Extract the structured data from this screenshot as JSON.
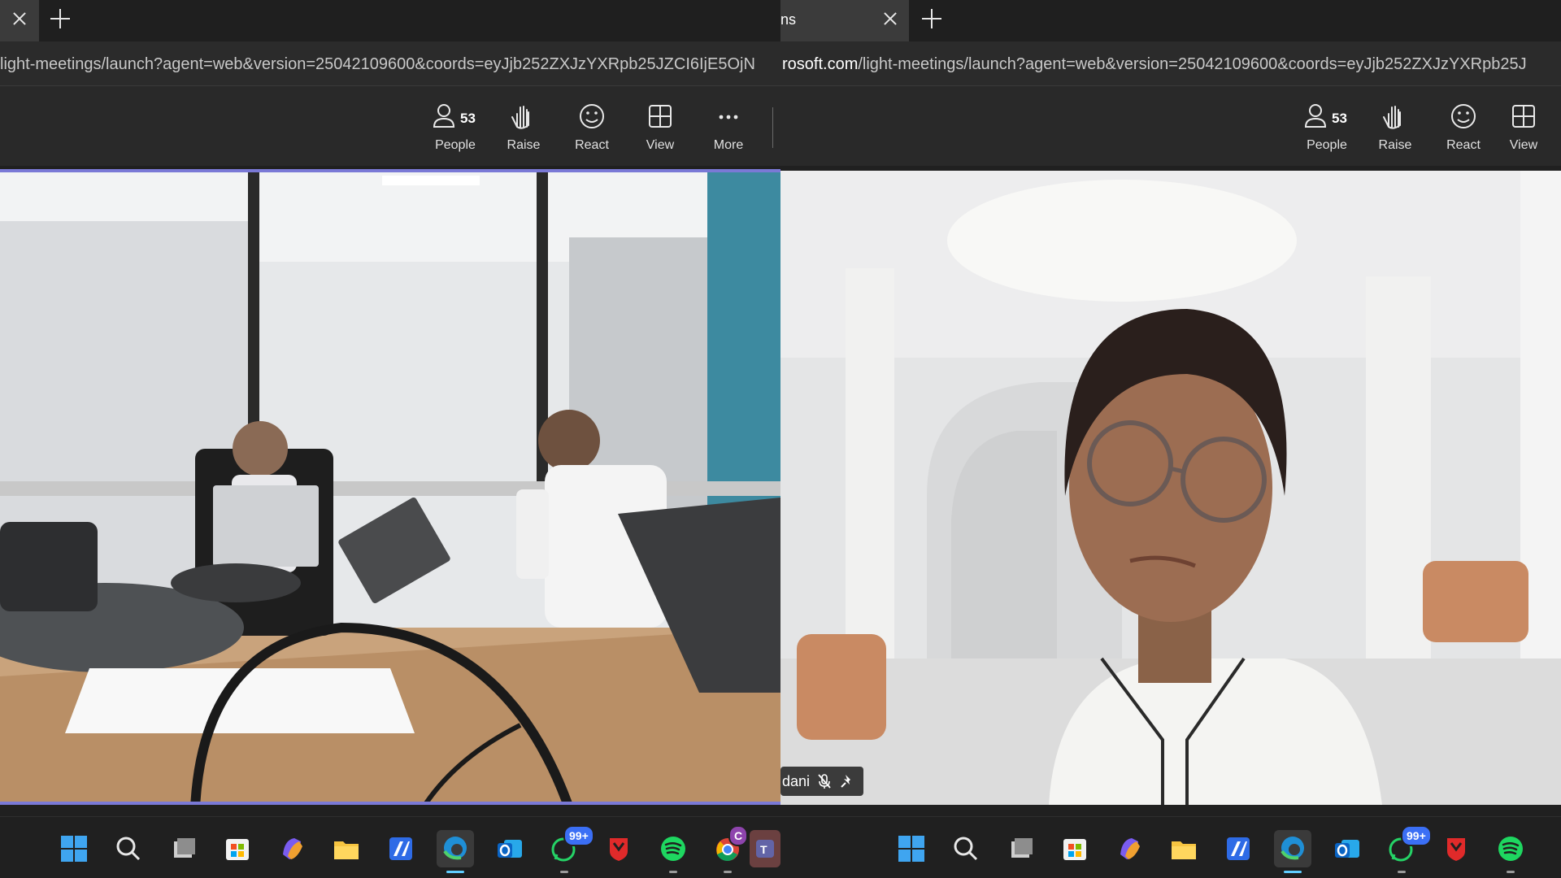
{
  "left_window": {
    "tab_title": "",
    "url_visible": "light-meetings/launch?agent=web&version=25042109600&coords=eyJjb252ZXJzYXRpb25JZCI6IjE5OjN",
    "toolbar": {
      "people_label": "People",
      "people_count": "53",
      "raise_label": "Raise",
      "react_label": "React",
      "view_label": "View",
      "more_label": "More"
    },
    "taskbar": {
      "whatsapp_badge": "99+",
      "chrome_badge": "C"
    }
  },
  "right_window": {
    "tab_title": "ns",
    "url_host": "rosoft.com",
    "url_path": "/light-meetings/launch?agent=web&version=25042109600&coords=eyJjb252ZXJzYXRpb25J",
    "toolbar": {
      "people_label": "People",
      "people_count": "53",
      "raise_label": "Raise",
      "react_label": "React",
      "view_label": "View"
    },
    "participant_name": "dani",
    "taskbar": {
      "whatsapp_badge": "99+"
    }
  }
}
